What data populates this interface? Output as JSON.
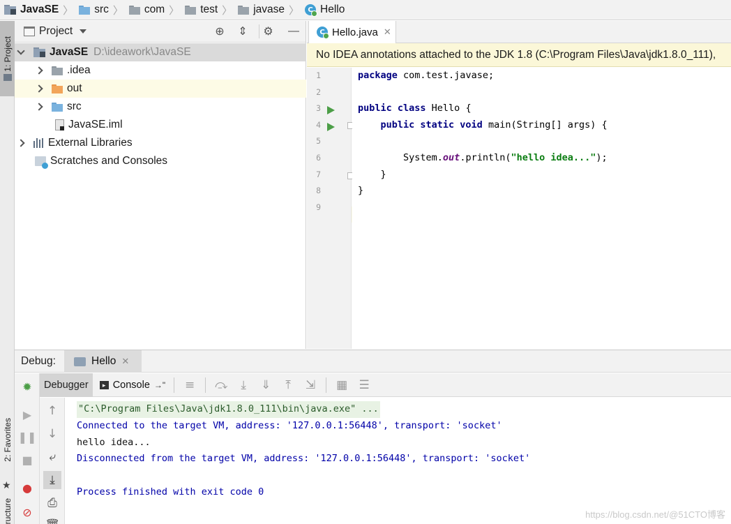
{
  "breadcrumb": {
    "items": [
      "JavaSE",
      "src",
      "com",
      "test",
      "javase",
      "Hello"
    ]
  },
  "left_strip": {
    "project_tab": "1: Project",
    "favorites_tab": "2: Favorites",
    "structure_tab": "ructure"
  },
  "project_panel": {
    "title": "Project",
    "root_name": "JavaSE",
    "root_path": "D:\\ideawork\\JavaSE",
    "items": [
      ".idea",
      "out",
      "src",
      "JavaSE.iml"
    ],
    "external_libraries": "External Libraries",
    "scratches": "Scratches and Consoles"
  },
  "editor": {
    "tab_label": "Hello.java",
    "banner": "No IDEA annotations attached to the JDK 1.8 (C:\\Program Files\\Java\\jdk1.8.0_111),",
    "line_numbers": [
      "1",
      "2",
      "3",
      "4",
      "5",
      "6",
      "7",
      "8",
      "9"
    ],
    "code": {
      "l1_kw": "package",
      "l1_rest": " com.test.javase;",
      "l3_kw": "public class",
      "l3_rest": " Hello {",
      "l4_indent": "    ",
      "l4_kw": "public static void",
      "l4_rest": " main(String[] args) {",
      "l6_a": "        System.",
      "l6_field": "out",
      "l6_b": ".println(",
      "l6_str": "\"hello idea...\"",
      "l6_c": ");",
      "l7": "    }",
      "l8": "}"
    }
  },
  "debug": {
    "label": "Debug:",
    "session_tab": "Hello",
    "debugger_tab": "Debugger",
    "console_tab": "Console",
    "console_tab_suffix": "→\"",
    "output": [
      "\"C:\\Program Files\\Java\\jdk1.8.0_111\\bin\\java.exe\" ...",
      "Connected to the target VM, address: '127.0.0.1:56448', transport: 'socket'",
      "hello idea...",
      "Disconnected from the target VM, address: '127.0.0.1:56448', transport: 'socket'",
      "",
      "Process finished with exit code 0"
    ]
  },
  "watermark": "https://blog.csdn.net/@51CTO博客",
  "colors": {
    "keyword": "#000080",
    "string": "#0b7d12",
    "field": "#660e7a",
    "console_info": "#0000a8",
    "run_green": "#4c9e47",
    "banner_bg": "#fbf7d8",
    "selection_bg": "#dadada"
  }
}
